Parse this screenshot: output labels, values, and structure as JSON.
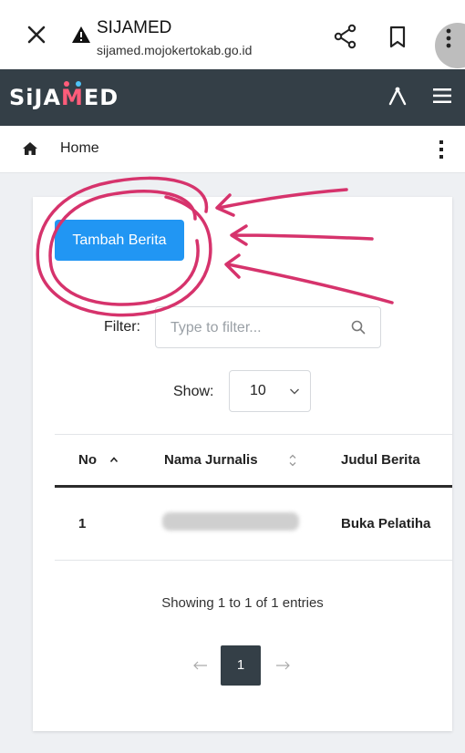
{
  "browser": {
    "title": "SIJAMED",
    "url": "sijamed.mojokertokab.go.id"
  },
  "app": {
    "brand_prefix": "SiJA",
    "brand_accent": "M",
    "brand_suffix": "ED",
    "accent_color": "#ff5c7a",
    "nav_color": "#343f47"
  },
  "breadcrumb": {
    "home_label": "Home"
  },
  "toolbar": {
    "add_label": "Tambah Berita",
    "button_color": "#2196f3"
  },
  "filter": {
    "label": "Filter:",
    "placeholder": "Type to filter..."
  },
  "show": {
    "label": "Show:",
    "value": "10"
  },
  "table": {
    "columns": [
      "No",
      "Nama Jurnalis",
      "Judul Berita"
    ],
    "rows": [
      {
        "no": "1",
        "judul": "Buka Pelatiha"
      }
    ]
  },
  "footer": {
    "entries_info": "Showing 1 to 1 of 1 entries",
    "prev": "←",
    "current_page": "1",
    "next": "→"
  },
  "annotation_color": "#d6336c"
}
